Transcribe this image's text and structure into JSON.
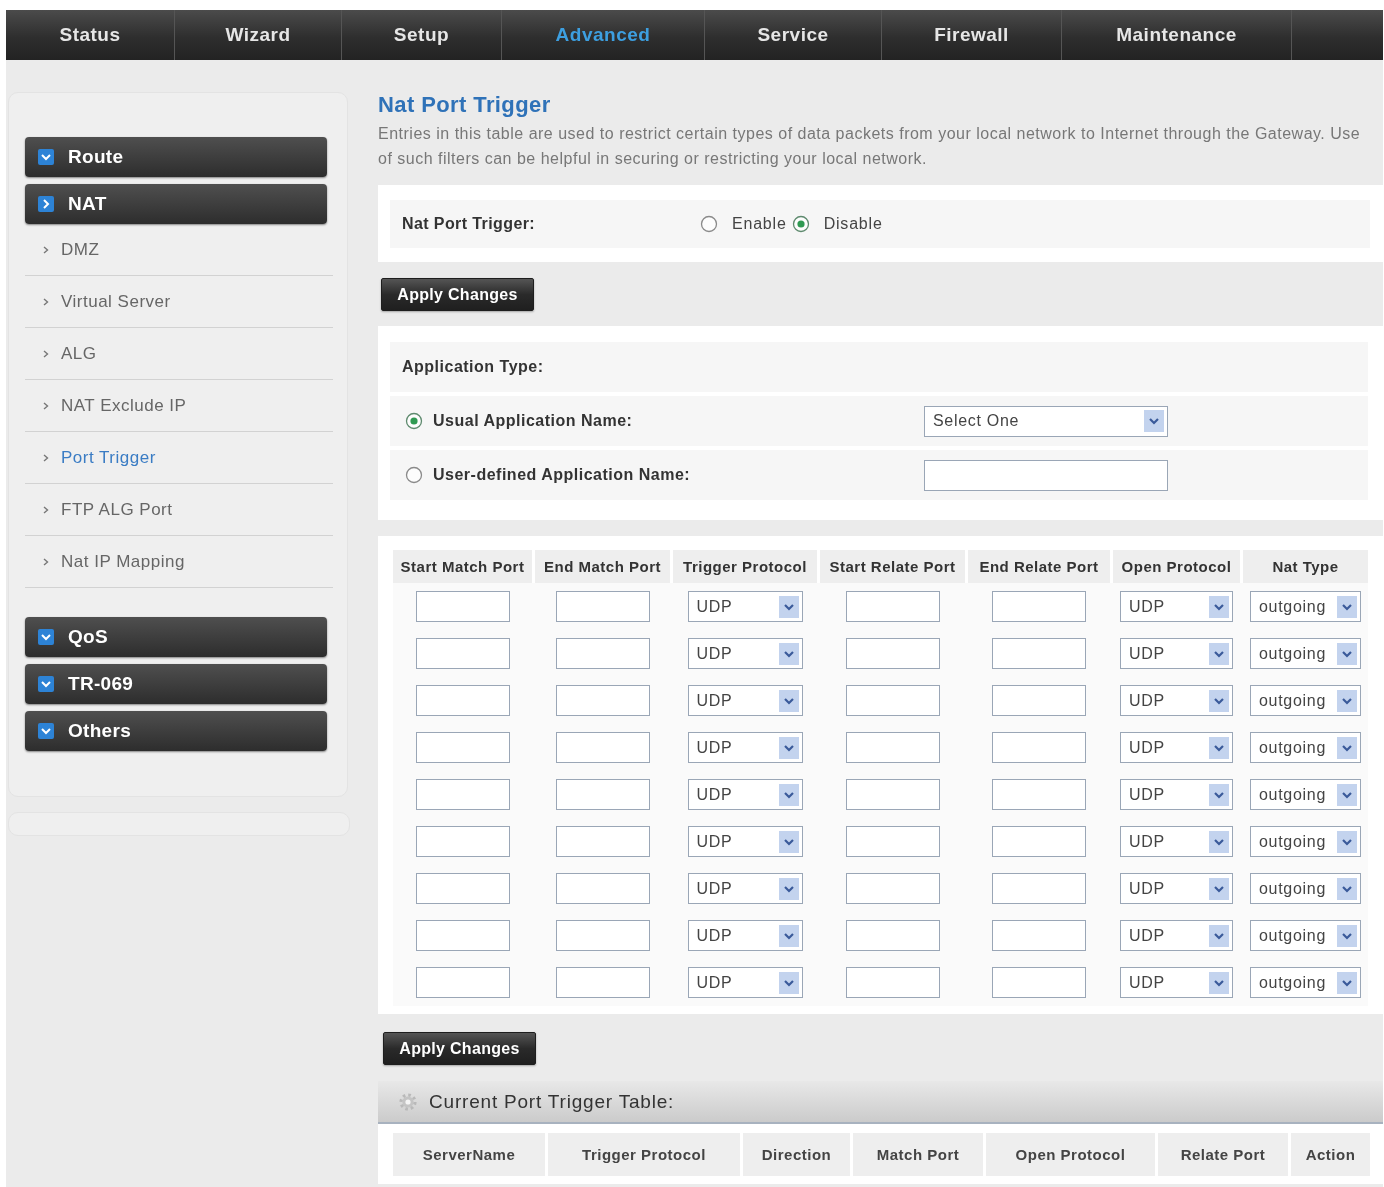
{
  "nav": {
    "tabs": [
      {
        "label": "Status",
        "selected": false
      },
      {
        "label": "Wizard",
        "selected": false
      },
      {
        "label": "Setup",
        "selected": false
      },
      {
        "label": "Advanced",
        "selected": true
      },
      {
        "label": "Service",
        "selected": false
      },
      {
        "label": "Firewall",
        "selected": false
      },
      {
        "label": "Maintenance",
        "selected": false
      }
    ]
  },
  "sidebar": {
    "groups": [
      {
        "label": "Route",
        "expanded": false
      },
      {
        "label": "NAT",
        "expanded": true,
        "children": [
          {
            "label": "DMZ",
            "selected": false
          },
          {
            "label": "Virtual Server",
            "selected": false
          },
          {
            "label": "ALG",
            "selected": false
          },
          {
            "label": "NAT Exclude IP",
            "selected": false
          },
          {
            "label": "Port Trigger",
            "selected": true
          },
          {
            "label": "FTP ALG Port",
            "selected": false
          },
          {
            "label": "Nat IP Mapping",
            "selected": false
          }
        ]
      },
      {
        "label": "QoS",
        "expanded": false
      },
      {
        "label": "TR-069",
        "expanded": false
      },
      {
        "label": "Others",
        "expanded": false
      }
    ]
  },
  "page": {
    "title": "Nat Port Trigger",
    "description": "Entries in this table are used to restrict certain types of data packets from your local network to Internet through the Gateway. Use of such filters can be helpful in securing or restricting your local network."
  },
  "trigger_setting": {
    "label": "Nat Port Trigger:",
    "options": [
      {
        "label": "Enable",
        "selected": false
      },
      {
        "label": "Disable",
        "selected": true
      }
    ],
    "button": "Apply Changes"
  },
  "application": {
    "heading": "Application Type:",
    "options": [
      {
        "label": "Usual Application Name:",
        "selected": true,
        "kind": "select",
        "value": "Select One"
      },
      {
        "label": "User-defined Application Name:",
        "selected": false,
        "kind": "text"
      }
    ]
  },
  "trigger_table": {
    "columns": [
      "Start Match Port",
      "End Match Port",
      "Trigger Protocol",
      "Start Relate Port",
      "End Relate Port",
      "Open Protocol",
      "Nat Type"
    ],
    "rows": [
      {
        "cells": [
          {
            "kind": "text"
          },
          {
            "kind": "text"
          },
          {
            "kind": "select",
            "value": "UDP"
          },
          {
            "kind": "text"
          },
          {
            "kind": "text"
          },
          {
            "kind": "select",
            "value": "UDP"
          },
          {
            "kind": "select",
            "value": "outgoing"
          }
        ]
      },
      {
        "cells": [
          {
            "kind": "text"
          },
          {
            "kind": "text"
          },
          {
            "kind": "select",
            "value": "UDP"
          },
          {
            "kind": "text"
          },
          {
            "kind": "text"
          },
          {
            "kind": "select",
            "value": "UDP"
          },
          {
            "kind": "select",
            "value": "outgoing"
          }
        ]
      },
      {
        "cells": [
          {
            "kind": "text"
          },
          {
            "kind": "text"
          },
          {
            "kind": "select",
            "value": "UDP"
          },
          {
            "kind": "text"
          },
          {
            "kind": "text"
          },
          {
            "kind": "select",
            "value": "UDP"
          },
          {
            "kind": "select",
            "value": "outgoing"
          }
        ]
      },
      {
        "cells": [
          {
            "kind": "text"
          },
          {
            "kind": "text"
          },
          {
            "kind": "select",
            "value": "UDP"
          },
          {
            "kind": "text"
          },
          {
            "kind": "text"
          },
          {
            "kind": "select",
            "value": "UDP"
          },
          {
            "kind": "select",
            "value": "outgoing"
          }
        ]
      },
      {
        "cells": [
          {
            "kind": "text"
          },
          {
            "kind": "text"
          },
          {
            "kind": "select",
            "value": "UDP"
          },
          {
            "kind": "text"
          },
          {
            "kind": "text"
          },
          {
            "kind": "select",
            "value": "UDP"
          },
          {
            "kind": "select",
            "value": "outgoing"
          }
        ]
      },
      {
        "cells": [
          {
            "kind": "text"
          },
          {
            "kind": "text"
          },
          {
            "kind": "select",
            "value": "UDP"
          },
          {
            "kind": "text"
          },
          {
            "kind": "text"
          },
          {
            "kind": "select",
            "value": "UDP"
          },
          {
            "kind": "select",
            "value": "outgoing"
          }
        ]
      },
      {
        "cells": [
          {
            "kind": "text"
          },
          {
            "kind": "text"
          },
          {
            "kind": "select",
            "value": "UDP"
          },
          {
            "kind": "text"
          },
          {
            "kind": "text"
          },
          {
            "kind": "select",
            "value": "UDP"
          },
          {
            "kind": "select",
            "value": "outgoing"
          }
        ]
      },
      {
        "cells": [
          {
            "kind": "text"
          },
          {
            "kind": "text"
          },
          {
            "kind": "select",
            "value": "UDP"
          },
          {
            "kind": "text"
          },
          {
            "kind": "text"
          },
          {
            "kind": "select",
            "value": "UDP"
          },
          {
            "kind": "select",
            "value": "outgoing"
          }
        ]
      },
      {
        "cells": [
          {
            "kind": "text"
          },
          {
            "kind": "text"
          },
          {
            "kind": "select",
            "value": "UDP"
          },
          {
            "kind": "text"
          },
          {
            "kind": "text"
          },
          {
            "kind": "select",
            "value": "UDP"
          },
          {
            "kind": "select",
            "value": "outgoing"
          }
        ]
      }
    ],
    "button": "Apply Changes"
  },
  "current_table": {
    "title": "Current Port Trigger Table:",
    "columns": [
      "ServerName",
      "Trigger Protocol",
      "Direction",
      "Match Port",
      "Open Protocol",
      "Relate Port",
      "Action"
    ]
  }
}
